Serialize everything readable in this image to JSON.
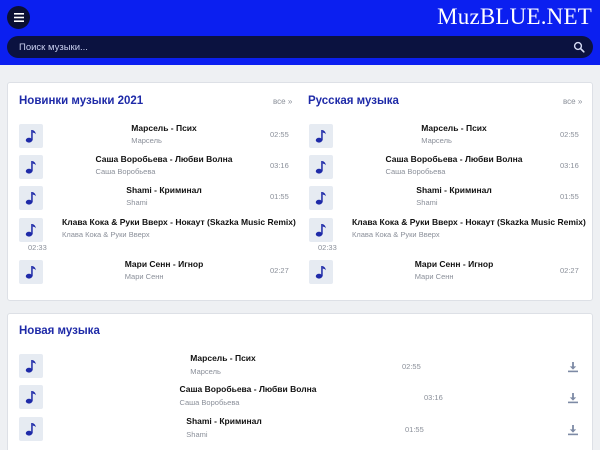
{
  "site": {
    "logo": "MuzBLUE.NET"
  },
  "search": {
    "placeholder": "Поиск музыки..."
  },
  "sections": {
    "new_2021": {
      "title": "Новинки музыки 2021",
      "all": "все",
      "tracks": [
        {
          "title": "Марсель - Псих",
          "artist": "Марсель",
          "duration": "02:55"
        },
        {
          "title": "Саша Воробьева - Любви Волна",
          "artist": "Саша Воробьева",
          "duration": "03:16"
        },
        {
          "title": "Shami - Криминал",
          "artist": "Shami",
          "duration": "01:55"
        },
        {
          "title": "Клава Кока & Руки Вверх - Нокаут (Skazka Music Remix)",
          "artist": "Клава Кока & Руки Вверх",
          "duration": "02:33"
        },
        {
          "title": "Мари Сенн - Игнор",
          "artist": "Мари Сенн",
          "duration": "02:27"
        }
      ]
    },
    "russian": {
      "title": "Русская музыка",
      "all": "все",
      "tracks": [
        {
          "title": "Марсель - Псих",
          "artist": "Марсель",
          "duration": "02:55"
        },
        {
          "title": "Саша Воробьева - Любви Волна",
          "artist": "Саша Воробьева",
          "duration": "03:16"
        },
        {
          "title": "Shami - Криминал",
          "artist": "Shami",
          "duration": "01:55"
        },
        {
          "title": "Клава Кока & Руки Вверх - Нокаут (Skazka Music Remix)",
          "artist": "Клава Кока & Руки Вверх",
          "duration": "02:33"
        },
        {
          "title": "Мари Сенн - Игнор",
          "artist": "Мари Сенн",
          "duration": "02:27"
        }
      ]
    },
    "new_music": {
      "title": "Новая музыка",
      "tracks": [
        {
          "title": "Марсель - Псих",
          "artist": "Марсель",
          "duration": "02:55"
        },
        {
          "title": "Саша Воробьева - Любви Волна",
          "artist": "Саша Воробьева",
          "duration": "03:16"
        },
        {
          "title": "Shami - Криминал",
          "artist": "Shami",
          "duration": "01:55"
        }
      ]
    }
  }
}
